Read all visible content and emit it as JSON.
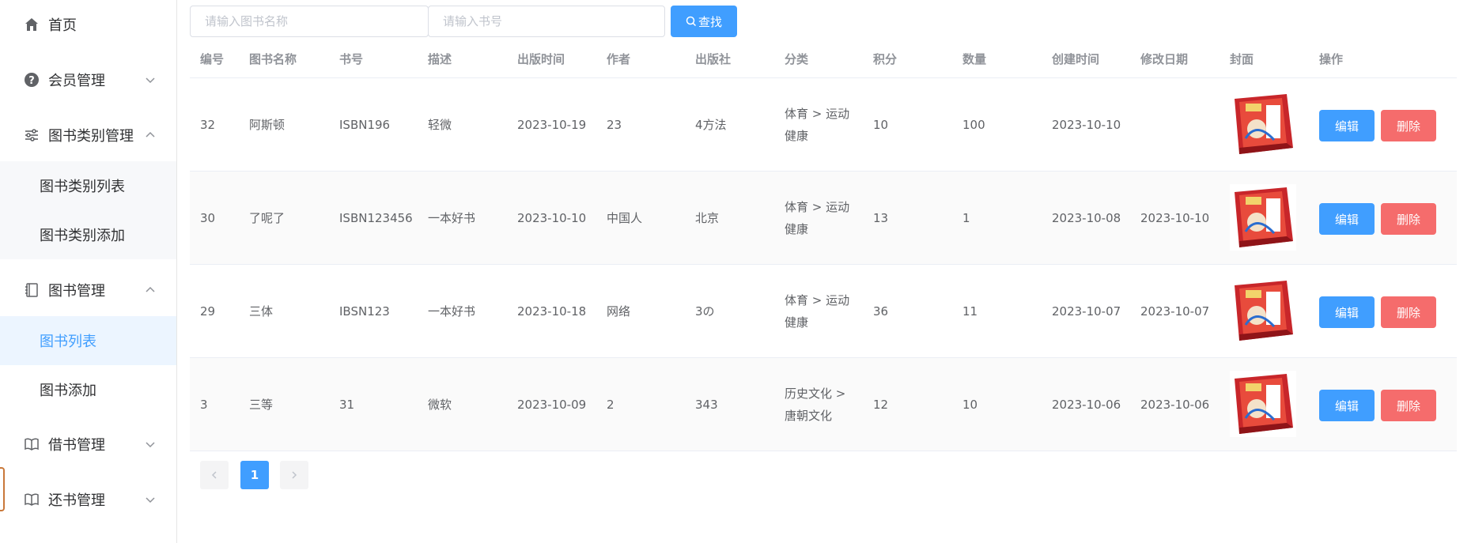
{
  "sidebar": {
    "home": "首页",
    "member": "会员管理",
    "category": "图书类别管理",
    "category_list": "图书类别列表",
    "category_add": "图书类别添加",
    "book": "图书管理",
    "book_list": "图书列表",
    "book_add": "图书添加",
    "borrow": "借书管理",
    "return": "还书管理"
  },
  "search": {
    "name_placeholder": "请输入图书名称",
    "isbn_placeholder": "请输入书号",
    "button": "查找"
  },
  "table": {
    "headers": [
      "编号",
      "图书名称",
      "书号",
      "描述",
      "出版时间",
      "作者",
      "出版社",
      "分类",
      "积分",
      "数量",
      "创建时间",
      "修改日期",
      "封面",
      "操作"
    ],
    "rows": [
      {
        "id": "32",
        "name": "阿斯顿",
        "isbn": "ISBN196",
        "desc": "轻微",
        "pub_date": "2023-10-19",
        "author": "23",
        "publisher": "4方法",
        "cat_line1": "体育 > 运动",
        "cat_line2": "健康",
        "points": "10",
        "qty": "100",
        "created": "2023-10-10",
        "modified": ""
      },
      {
        "id": "30",
        "name": "了呢了",
        "isbn": "ISBN123456",
        "desc": "一本好书",
        "pub_date": "2023-10-10",
        "author": "中国人",
        "publisher": "北京",
        "cat_line1": "体育 > 运动",
        "cat_line2": "健康",
        "points": "13",
        "qty": "1",
        "created": "2023-10-08",
        "modified": "2023-10-10"
      },
      {
        "id": "29",
        "name": "三体",
        "isbn": "IBSN123",
        "desc": "一本好书",
        "pub_date": "2023-10-18",
        "author": "网络",
        "publisher": "3の",
        "cat_line1": "体育 > 运动",
        "cat_line2": "健康",
        "points": "36",
        "qty": "11",
        "created": "2023-10-07",
        "modified": "2023-10-07"
      },
      {
        "id": "3",
        "name": "三等",
        "isbn": "31",
        "desc": "微软",
        "pub_date": "2023-10-09",
        "author": "2",
        "publisher": "343",
        "cat_line1": "历史文化 >",
        "cat_line2": "唐朝文化",
        "points": "12",
        "qty": "10",
        "created": "2023-10-06",
        "modified": "2023-10-06"
      }
    ],
    "edit_label": "编辑",
    "delete_label": "删除"
  },
  "pagination": {
    "current": "1",
    "prev_icon": "chevron-left-icon",
    "next_icon": "chevron-right-icon"
  },
  "colors": {
    "primary": "#409eff",
    "danger": "#f56c6c",
    "active_bg": "#ecf5ff"
  }
}
